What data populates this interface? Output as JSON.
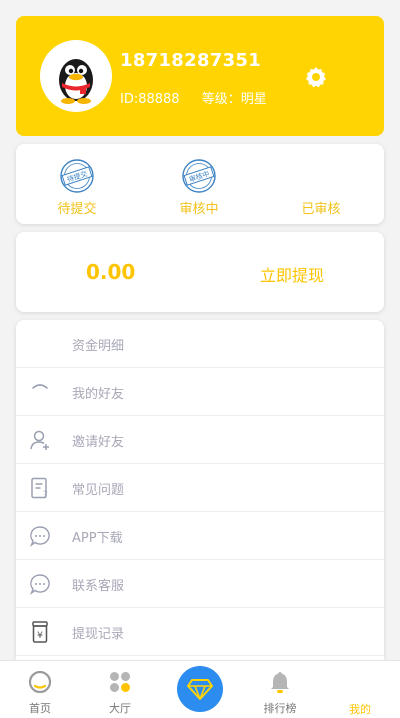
{
  "profile": {
    "phone": "18718287351",
    "id_text": "ID:88888",
    "level_text": "等级：明星"
  },
  "statuses": [
    {
      "label": "待提交",
      "stamp": "待提交"
    },
    {
      "label": "审核中",
      "stamp": "审核中"
    },
    {
      "label": "已审核",
      "stamp": ""
    }
  ],
  "wallet": {
    "balance": "0.00",
    "withdraw_label": "立即提现"
  },
  "menu": [
    {
      "label": "资金明细",
      "icon": "none"
    },
    {
      "label": "我的好友",
      "icon": "friends-icon"
    },
    {
      "label": "邀请好友",
      "icon": "invite-user-icon"
    },
    {
      "label": "常见问题",
      "icon": "faq-document-icon"
    },
    {
      "label": "APP下载",
      "icon": "chat-bubble-icon"
    },
    {
      "label": "联系客服",
      "icon": "chat-bubble-icon"
    },
    {
      "label": "提现记录",
      "icon": "withdraw-record-icon"
    }
  ],
  "tabs": [
    {
      "label": "首页",
      "icon": "home-icon"
    },
    {
      "label": "大厅",
      "icon": "lobby-dots-icon"
    },
    {
      "label": "",
      "icon": "diamond-icon"
    },
    {
      "label": "排行榜",
      "icon": "bell-icon"
    },
    {
      "label": "我的",
      "icon": "profile-icon"
    }
  ],
  "colors": {
    "accent": "#ffd400",
    "accent_text": "#ffc400",
    "center_button": "#2d8cf0",
    "menu_text": "#a8a8b8"
  }
}
